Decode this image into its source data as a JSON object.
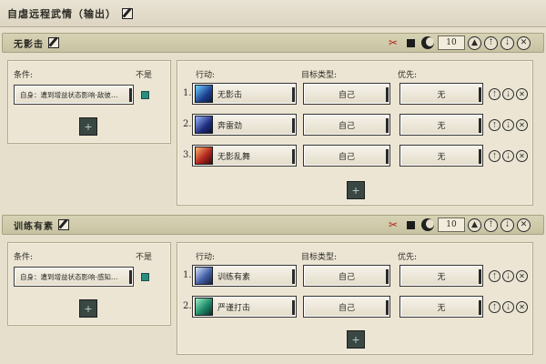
{
  "window": {
    "title": "自虐远程武情（输出）"
  },
  "sections": [
    {
      "name": "无影击",
      "number": "10",
      "condition_label": "条件:",
      "not_label": "不是",
      "condition_text": "自身：遭到增益状态影响·敌彼…",
      "action_label": "行动:",
      "target_label": "目标类型:",
      "priority_label": "优先:",
      "rows": [
        {
          "num": "1.",
          "skill": "无影击",
          "target": "自己",
          "priority": "无"
        },
        {
          "num": "2.",
          "skill": "奔雷劲",
          "target": "自己",
          "priority": "无"
        },
        {
          "num": "3.",
          "skill": "无影乱舞",
          "target": "自己",
          "priority": "无"
        }
      ]
    },
    {
      "name": "训练有素",
      "number": "10",
      "condition_label": "条件:",
      "not_label": "不是",
      "condition_text": "自身：遭到增益状态影响·感知…",
      "action_label": "行动:",
      "target_label": "目标类型:",
      "priority_label": "优先:",
      "rows": [
        {
          "num": "1.",
          "skill": "训练有素",
          "target": "自己",
          "priority": "无"
        },
        {
          "num": "2.",
          "skill": "严谨打击",
          "target": "自己",
          "priority": "无"
        }
      ]
    }
  ],
  "icons": {
    "edit": "edit-icon",
    "scissors": "scissors-icon",
    "stop": "stop-icon",
    "moon": "moon-icon",
    "up": "arrow-up-icon",
    "down": "arrow-down-icon",
    "close": "close-icon",
    "add": "add-icon"
  },
  "colors": {
    "background": "#e6dfcc",
    "header": "#ccc8a8",
    "accent_teal": "#2a8d7d",
    "scissors_red": "#b3261e"
  }
}
